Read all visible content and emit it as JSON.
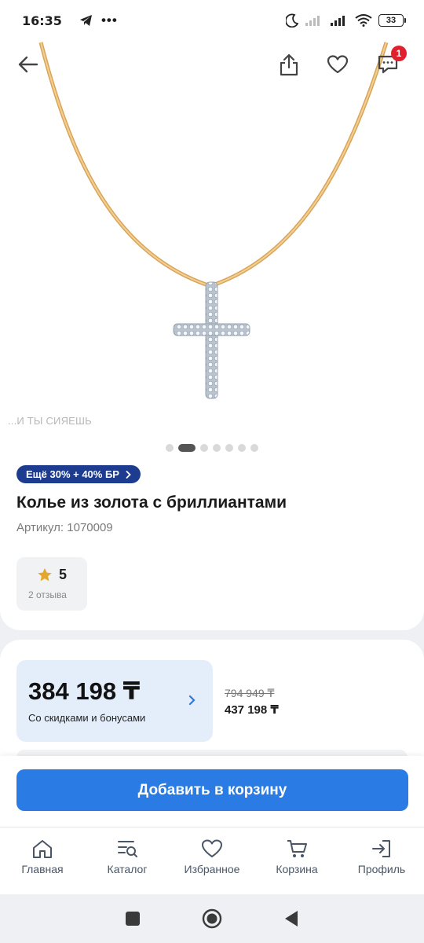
{
  "status": {
    "time": "16:35",
    "battery": "33"
  },
  "hero": {
    "slogan": "...И ТЫ СИЯЕШЬ",
    "slides_total": 7,
    "active_slide": 2,
    "notifications": "1"
  },
  "product": {
    "promo": "Ещё 30% + 40% БР",
    "title": "Колье из золота с бриллиантами",
    "article": "Артикул: 1070009",
    "rating": "5",
    "reviews": "2 отзыва"
  },
  "price": {
    "current": "384 198 ₸",
    "note": "Со скидками и бонусами",
    "old": "794 949 ₸",
    "mid": "437 198 ₸"
  },
  "cart": {
    "add_label": "Добавить в корзину"
  },
  "nav": [
    {
      "label": "Главная",
      "icon": "home-icon"
    },
    {
      "label": "Каталог",
      "icon": "catalog-icon"
    },
    {
      "label": "Избранное",
      "icon": "heart-icon"
    },
    {
      "label": "Корзина",
      "icon": "cart-icon"
    },
    {
      "label": "Профиль",
      "icon": "login-icon"
    }
  ],
  "colors": {
    "accent": "#2a7be4",
    "promo": "#1d3b8f",
    "badge": "#e0202e",
    "price_card": "#e4eefb"
  }
}
